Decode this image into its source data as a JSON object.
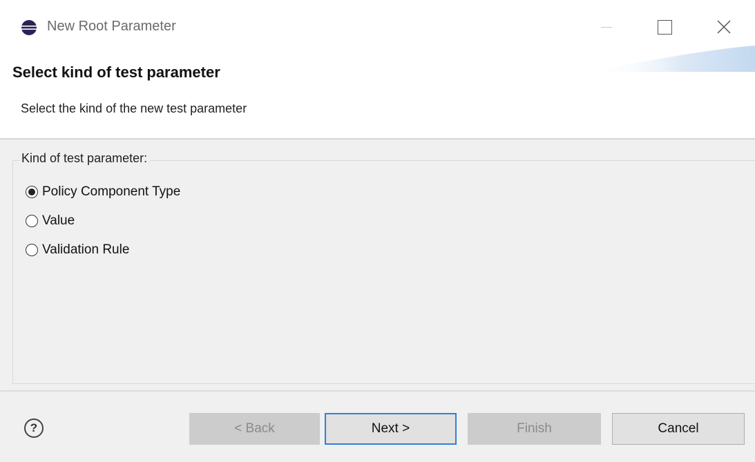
{
  "window": {
    "title": "New Root Parameter",
    "icon": "eclipse-icon",
    "controls": [
      "minimize-icon",
      "maximize-icon",
      "close-icon"
    ]
  },
  "header": {
    "title": "Select kind of test parameter",
    "description": "Select the kind of the new test parameter"
  },
  "group": {
    "label": "Kind of test parameter:",
    "options": [
      {
        "label": "Policy Component Type",
        "selected": true
      },
      {
        "label": "Value",
        "selected": false
      },
      {
        "label": "Validation Rule",
        "selected": false
      }
    ]
  },
  "footer": {
    "help_symbol": "?",
    "back_label": "< Back",
    "next_label": "Next >",
    "finish_label": "Finish",
    "cancel_label": "Cancel"
  },
  "colors": {
    "focus_border": "#2f7fd6",
    "content_bg": "#f0f0f0",
    "disabled_text": "#8a8a8a"
  }
}
